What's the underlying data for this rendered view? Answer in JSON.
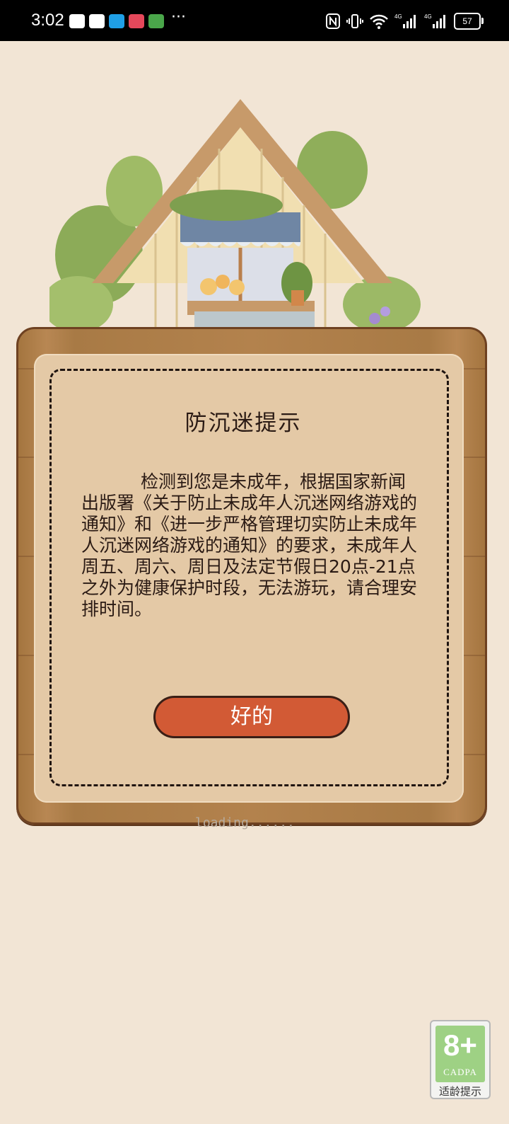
{
  "status_bar": {
    "time": "3:02",
    "more": "···",
    "battery": "57"
  },
  "dialog": {
    "title": "防沉迷提示",
    "message": "检测到您是未成年，根据国家新闻出版署《关于防止未成年人沉迷网络游戏的通知》和《进一步严格管理切实防止未成年人沉迷网络游戏的通知》的要求，未成年人周五、周六、周日及法定节假日20点-21点之外为健康保护时段，无法游玩，请合理安排时间。",
    "ok_label": "好的"
  },
  "loading_text": "loading......",
  "age_badge": {
    "age": "8+",
    "org": "CADPA",
    "label": "适龄提示"
  },
  "colors": {
    "background": "#f2e5d5",
    "board": "#b3824d",
    "panel": "#e4c9a6",
    "button": "#d25a35",
    "badge_green": "#9ed184"
  }
}
